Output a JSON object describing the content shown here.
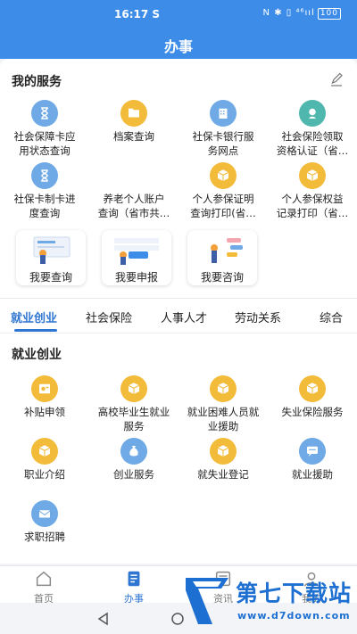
{
  "status": {
    "time": "16:17",
    "time_suffix": "S",
    "icons": "N ✱ ▯ ⁴⁶ııl",
    "battery": "100"
  },
  "header": {
    "title": "办事"
  },
  "my_services": {
    "title": "我的服务",
    "items": [
      {
        "label": "社会保障卡应\n用状态查询",
        "icon": "hourglass-icon",
        "color": "blue"
      },
      {
        "label": "档案查询",
        "icon": "folder-icon",
        "color": "yellow"
      },
      {
        "label": "社保卡银行服\n务网点",
        "icon": "bank-building-icon",
        "color": "blue"
      },
      {
        "label": "社会保险领取\n资格认证（省…",
        "icon": "certify-icon",
        "color": "teal"
      },
      {
        "label": "社保卡制卡进\n度查询",
        "icon": "hourglass-icon",
        "color": "blue"
      },
      {
        "label": "养老个人账户\n查询（省市共…",
        "icon": "none",
        "color": "none"
      },
      {
        "label": "个人参保证明\n查询打印(省…",
        "icon": "box-icon",
        "color": "yellow"
      },
      {
        "label": "个人参保权益\n记录打印（省…",
        "icon": "box-icon",
        "color": "yellow"
      }
    ],
    "cards": [
      {
        "label": "我要查询",
        "icon": "query-illustration-icon"
      },
      {
        "label": "我要申报",
        "icon": "declare-illustration-icon"
      },
      {
        "label": "我要咨询",
        "icon": "consult-illustration-icon"
      }
    ]
  },
  "tabs": [
    {
      "label": "就业创业",
      "active": true
    },
    {
      "label": "社会保险",
      "active": false
    },
    {
      "label": "人事人才",
      "active": false
    },
    {
      "label": "劳动关系",
      "active": false
    },
    {
      "label": "综合",
      "active": false
    }
  ],
  "employment": {
    "title": "就业创业",
    "items": [
      {
        "label": "补贴申领",
        "icon": "subsidy-icon",
        "color": "yellow"
      },
      {
        "label": "高校毕业生就业\n服务",
        "icon": "box-icon",
        "color": "yellow"
      },
      {
        "label": "就业困难人员就\n业援助",
        "icon": "box-icon",
        "color": "yellow"
      },
      {
        "label": "失业保险服务",
        "icon": "box-icon",
        "color": "yellow"
      },
      {
        "label": "职业介绍",
        "icon": "box-icon",
        "color": "yellow"
      },
      {
        "label": "创业服务",
        "icon": "money-bag-icon",
        "color": "blue"
      },
      {
        "label": "就失业登记",
        "icon": "box-icon",
        "color": "yellow"
      },
      {
        "label": "就业援助",
        "icon": "chat-icon",
        "color": "blue"
      },
      {
        "label": "求职招聘",
        "icon": "mail-icon",
        "color": "blue"
      }
    ]
  },
  "bottom_nav": [
    {
      "label": "首页",
      "icon": "home-icon",
      "active": false
    },
    {
      "label": "办事",
      "icon": "document-edit-icon",
      "active": true
    },
    {
      "label": "资讯",
      "icon": "news-icon",
      "active": false
    },
    {
      "label": "我的",
      "icon": "user-icon",
      "active": false
    }
  ],
  "watermark": {
    "text": "第七下载站",
    "url": "www.d7down.com"
  },
  "colors": {
    "primary": "#3d8ce8",
    "accent": "#2f76d2",
    "yellow": "#f3bb3a",
    "blue": "#6fa9e6",
    "teal": "#4fb7ad"
  }
}
